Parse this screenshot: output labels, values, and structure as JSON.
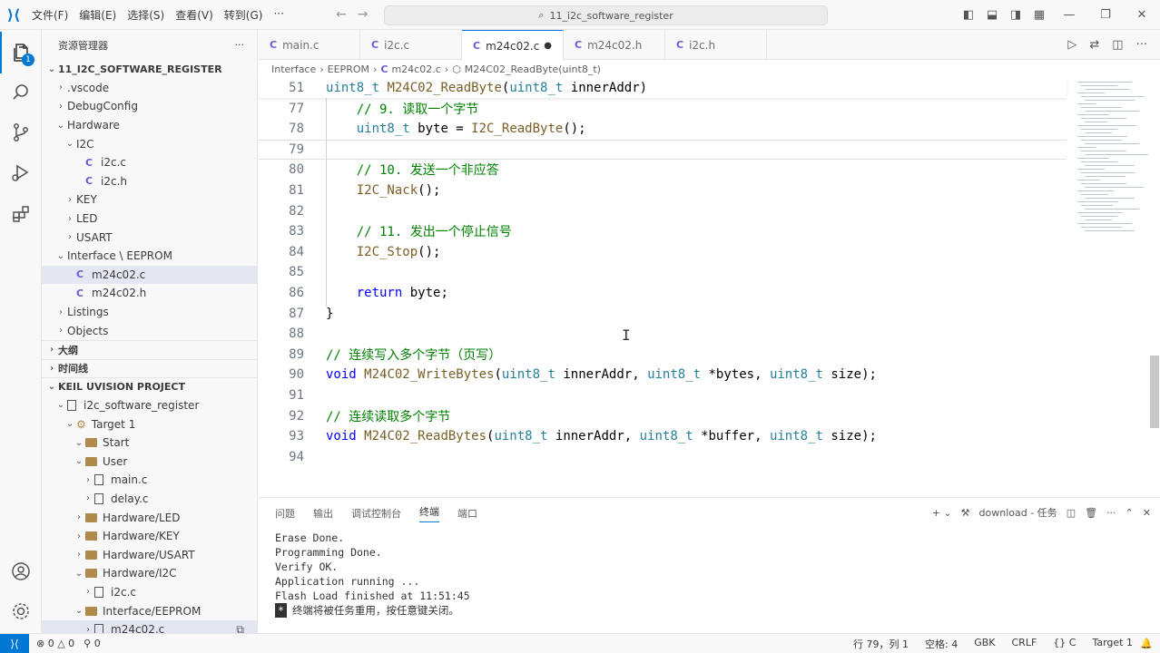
{
  "menu": [
    "文件(F)",
    "编辑(E)",
    "选择(S)",
    "查看(V)",
    "转到(G)",
    "···"
  ],
  "command_center": "11_i2c_software_register",
  "activity": {
    "explorer_badge": "1"
  },
  "sidebar": {
    "title": "资源管理器",
    "more": "···",
    "root": "11_I2C_SOFTWARE_REGISTER",
    "tree": [
      {
        "label": ".vscode",
        "depth": 1,
        "chev": "›",
        "icon": ""
      },
      {
        "label": "DebugConfig",
        "depth": 1,
        "chev": "›",
        "icon": ""
      },
      {
        "label": "Hardware",
        "depth": 1,
        "chev": "⌄",
        "icon": ""
      },
      {
        "label": "I2C",
        "depth": 2,
        "chev": "⌄",
        "icon": ""
      },
      {
        "label": "i2c.c",
        "depth": 3,
        "chev": "",
        "icon": "C"
      },
      {
        "label": "i2c.h",
        "depth": 3,
        "chev": "",
        "icon": "C"
      },
      {
        "label": "KEY",
        "depth": 2,
        "chev": "›",
        "icon": ""
      },
      {
        "label": "LED",
        "depth": 2,
        "chev": "›",
        "icon": ""
      },
      {
        "label": "USART",
        "depth": 2,
        "chev": "›",
        "icon": ""
      },
      {
        "label": "Interface \\ EEPROM",
        "depth": 1,
        "chev": "⌄",
        "icon": ""
      },
      {
        "label": "m24c02.c",
        "depth": 2,
        "chev": "",
        "icon": "C",
        "selected": true
      },
      {
        "label": "m24c02.h",
        "depth": 2,
        "chev": "",
        "icon": "C"
      },
      {
        "label": "Listings",
        "depth": 1,
        "chev": "›",
        "icon": ""
      },
      {
        "label": "Objects",
        "depth": 1,
        "chev": "›",
        "icon": ""
      }
    ],
    "outline": "大纲",
    "timeline": "时间线",
    "keil_title": "KEIL UVISION PROJECT",
    "keil_tree": [
      {
        "label": "i2c_software_register",
        "depth": 1,
        "chev": "⌄",
        "kind": "proj"
      },
      {
        "label": "Target 1",
        "depth": 2,
        "chev": "⌄",
        "kind": "target"
      },
      {
        "label": "Start",
        "depth": 3,
        "chev": "⌄",
        "kind": "folder"
      },
      {
        "label": "User",
        "depth": 3,
        "chev": "⌄",
        "kind": "folder"
      },
      {
        "label": "main.c",
        "depth": 4,
        "chev": "›",
        "kind": "file"
      },
      {
        "label": "delay.c",
        "depth": 4,
        "chev": "›",
        "kind": "file"
      },
      {
        "label": "Hardware/LED",
        "depth": 3,
        "chev": "›",
        "kind": "folder"
      },
      {
        "label": "Hardware/KEY",
        "depth": 3,
        "chev": "›",
        "kind": "folder"
      },
      {
        "label": "Hardware/USART",
        "depth": 3,
        "chev": "›",
        "kind": "folder"
      },
      {
        "label": "Hardware/I2C",
        "depth": 3,
        "chev": "⌄",
        "kind": "folder"
      },
      {
        "label": "i2c.c",
        "depth": 4,
        "chev": "›",
        "kind": "file"
      },
      {
        "label": "Interface/EEPROM",
        "depth": 3,
        "chev": "⌄",
        "kind": "folder"
      },
      {
        "label": "m24c02.c",
        "depth": 4,
        "chev": "›",
        "kind": "file",
        "selected": true
      }
    ]
  },
  "tabs": [
    {
      "label": "main.c",
      "active": false
    },
    {
      "label": "i2c.c",
      "active": false
    },
    {
      "label": "m24c02.c",
      "active": true,
      "dirty": "●"
    },
    {
      "label": "m24c02.h",
      "active": false
    },
    {
      "label": "i2c.h",
      "active": false
    }
  ],
  "breadcrumb": {
    "p1": "Interface",
    "p2": "EEPROM",
    "p3": "m24c02.c",
    "p4": "M24C02_ReadByte(uint8_t)"
  },
  "code_lines": [
    {
      "n": "51",
      "html": "<span class='ty'>uint8_t</span> <span class='fn'>M24C02_ReadByte</span>(<span class='ty'>uint8_t</span> innerAddr)",
      "sticky": true
    },
    {
      "n": "77",
      "html": "    <span class='cm'>// 9. 读取一个字节</span>"
    },
    {
      "n": "78",
      "html": "    <span class='ty'>uint8_t</span> byte = <span class='fn'>I2C_ReadByte</span>();"
    },
    {
      "n": "79",
      "html": "",
      "current": true
    },
    {
      "n": "80",
      "html": "    <span class='cm'>// 10. 发送一个非应答</span>"
    },
    {
      "n": "81",
      "html": "    <span class='fn'>I2C_Nack</span>();"
    },
    {
      "n": "82",
      "html": ""
    },
    {
      "n": "83",
      "html": "    <span class='cm'>// 11. 发出一个停止信号</span>"
    },
    {
      "n": "84",
      "html": "    <span class='fn'>I2C_Stop</span>();"
    },
    {
      "n": "85",
      "html": ""
    },
    {
      "n": "86",
      "html": "    <span class='kw'>return</span> byte;"
    },
    {
      "n": "87",
      "html": "}"
    },
    {
      "n": "88",
      "html": ""
    },
    {
      "n": "89",
      "html": "<span class='cm'>// 连续写入多个字节（页写）</span>"
    },
    {
      "n": "90",
      "html": "<span class='kw'>void</span> <span class='fn'>M24C02_WriteBytes</span>(<span class='ty'>uint8_t</span> innerAddr, <span class='ty'>uint8_t</span> *bytes, <span class='ty'>uint8_t</span> size);"
    },
    {
      "n": "91",
      "html": ""
    },
    {
      "n": "92",
      "html": "<span class='cm'>// 连续读取多个字节</span>"
    },
    {
      "n": "93",
      "html": "<span class='kw'>void</span> <span class='fn'>M24C02_ReadBytes</span>(<span class='ty'>uint8_t</span> innerAddr, <span class='ty'>uint8_t</span> *buffer, <span class='ty'>uint8_t</span> size);"
    },
    {
      "n": "94",
      "html": ""
    }
  ],
  "panel": {
    "tabs": [
      "问题",
      "输出",
      "调试控制台",
      "终端",
      "端口"
    ],
    "active_tab": "终端",
    "task_label": "download - 任务",
    "terminal_lines": [
      "Erase Done.",
      "Programming Done.",
      "Verify OK.",
      "Application running ...",
      "Flash Load finished at 11:51:45"
    ],
    "terminal_final": "终端将被任务重用，按任意键关闭。"
  },
  "status": {
    "errors": "0",
    "warnings": "0",
    "ports": "0",
    "position": "行 79，列 1",
    "spaces": "空格: 4",
    "encoding": "GBK",
    "eol": "CRLF",
    "language": "C",
    "target": "Target 1"
  }
}
